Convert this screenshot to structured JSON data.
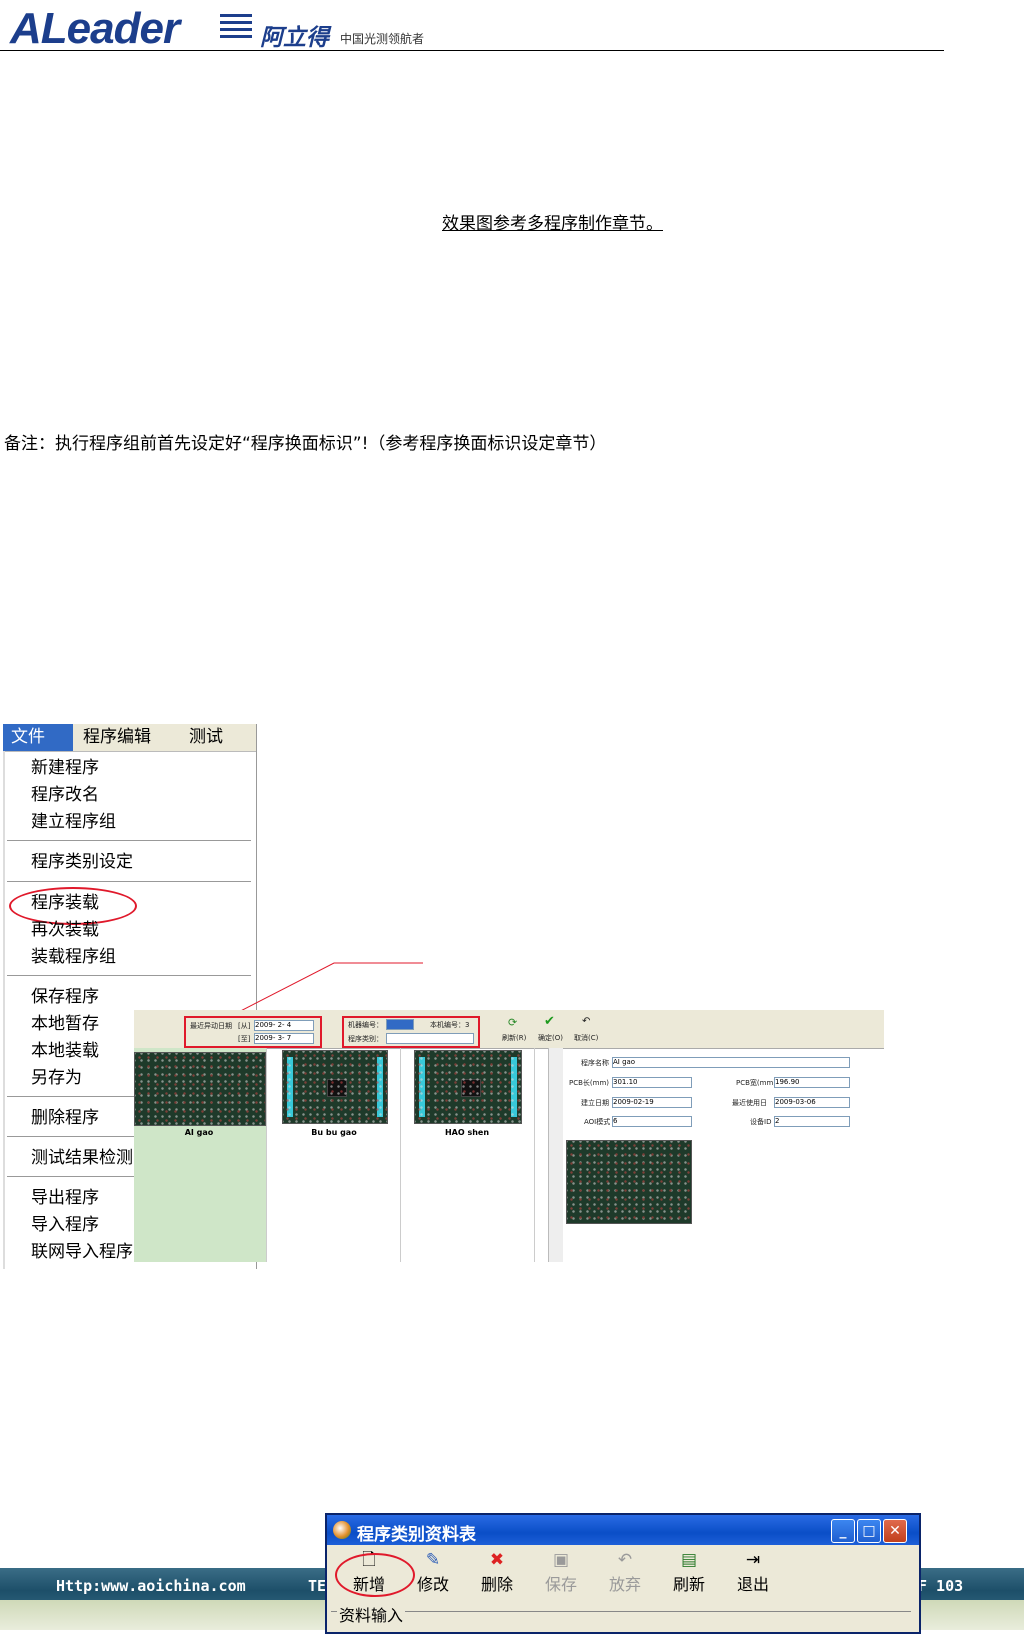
{
  "header": {
    "logo_latin": "ALeader",
    "logo_cn": "阿立得",
    "slogan": "中国光测领航者"
  },
  "body": {
    "reference_text": "效果图参考多程序制作章节。",
    "note_text": "备注：执行程序组前首先设定好“程序换面标识”!（参考程序换面标识设定章节）"
  },
  "menu": {
    "tabs": [
      "文件",
      "程序编辑",
      "测试"
    ],
    "items": {
      "new_program": "新建程序",
      "rename_program": "程序改名",
      "create_group": "建立程序组",
      "category_setting": "程序类别设定",
      "load_program": "程序装载",
      "reload": "再次装载",
      "load_group": "装载程序组",
      "save_program": "保存程序",
      "local_temp_save": "本地暂存",
      "local_load": "本地装载",
      "save_as": "另存为",
      "delete_program": "删除程序",
      "test_result": "测试结果检测",
      "export_program": "导出程序",
      "import_program": "导入程序",
      "network_import": "联网导入程序"
    }
  },
  "app": {
    "date_label": "最近异动日期",
    "from_label": "[从]",
    "to_label": "[至]",
    "from_value": "2009- 2- 4",
    "to_value": "2009- 3- 7",
    "machine_no_label": "机器编号：",
    "local_no_label": "本机编号：3",
    "category_label": "程序类别：",
    "btn_refresh": "刷新(R)",
    "btn_ok": "确定(O)",
    "btn_cancel": "取消(C)",
    "programs": [
      "AI gao",
      "Bu bu gao",
      "HAO shen"
    ],
    "details": {
      "name_label": "程序名称",
      "name_value": "AI gao",
      "pcb_len_label": "PCB长(mm)",
      "pcb_len_value": "301.10",
      "pcb_wid_label": "PCB宽(mm)",
      "pcb_wid_value": "196.90",
      "created_label": "建立日期",
      "created_value": "2009-02-19",
      "last_used_label": "最近使用日",
      "last_used_value": "2009-03-06",
      "aoi_mode_label": "AOI模式",
      "aoi_mode_value": "6",
      "device_id_label": "设备ID",
      "device_id_value": "2"
    }
  },
  "footer": {
    "url": "Http:www.aoichina.com",
    "fragment": "TE",
    "page": "F 103"
  },
  "dialog": {
    "title": "程序类别资料表",
    "buttons": {
      "add": "新增",
      "edit": "修改",
      "delete": "删除",
      "save": "保存",
      "discard": "放弃",
      "refresh": "刷新",
      "exit": "退出"
    },
    "group_label": "资料输入"
  },
  "colors": {
    "brand_blue": "#1c3e8c",
    "highlight_red": "#e0192b",
    "menu_selected": "#316ac5",
    "footer_band": "#1d4f69"
  }
}
